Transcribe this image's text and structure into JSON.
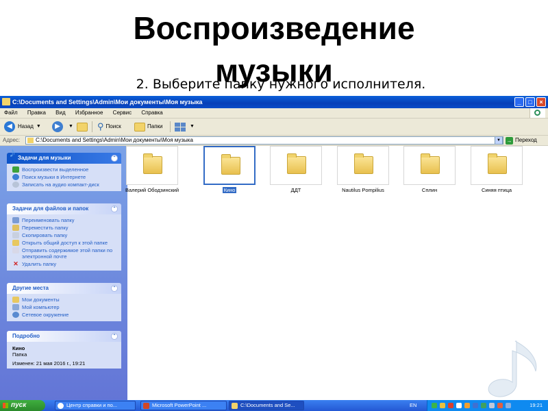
{
  "slide": {
    "title_line1": "Воспроизведение",
    "title_line2": "музыки",
    "subtitle": "2. Выберите папку нужного исполнителя."
  },
  "window": {
    "title": "C:\\Documents and Settings\\Admin\\Мои документы\\Моя музыка",
    "menu": [
      "Файл",
      "Правка",
      "Вид",
      "Избранное",
      "Сервис",
      "Справка"
    ],
    "toolbar": {
      "back_label": "Назад",
      "search_label": "Поиск",
      "folders_label": "Папки"
    },
    "address": {
      "label": "Адрес:",
      "value": "C:\\Documents and Settings\\Admin\\Мои документы\\Моя музыка",
      "go_label": "Переход"
    }
  },
  "taskpane": {
    "music_tasks": {
      "header": "Задачи для музыки",
      "items": [
        "Воспроизвести выделенное",
        "Поиск музыки в Интернете",
        "Записать на аудио компакт-диск"
      ]
    },
    "file_tasks": {
      "header": "Задачи для файлов и папок",
      "items": [
        "Переименовать папку",
        "Переместить папку",
        "Скопировать папку",
        "Открыть общий доступ к этой папке",
        "Отправить содержимое этой папки по электронной почте",
        "Удалить папку"
      ]
    },
    "other_places": {
      "header": "Другие места",
      "items": [
        "Мои документы",
        "Мой компьютер",
        "Сетевое окружение"
      ]
    },
    "details": {
      "header": "Подробно",
      "name": "Кино",
      "type": "Папка",
      "modified": "Изменен: 21 мая 2016 г., 19:21"
    }
  },
  "folders": [
    {
      "name": "Валерий Ободзинский",
      "selected": false
    },
    {
      "name": "Кино",
      "selected": true
    },
    {
      "name": "ДДТ",
      "selected": false
    },
    {
      "name": "Nautilus Pompilius",
      "selected": false
    },
    {
      "name": "Сплин",
      "selected": false
    },
    {
      "name": "Синяя птица",
      "selected": false
    }
  ],
  "taskbar": {
    "start_label": "пуск",
    "tasks": [
      "Центр справки и по...",
      "Microsoft PowerPoint ...",
      "C:\\Documents and Se..."
    ],
    "lang": "EN",
    "clock": "19:21"
  },
  "colors": {
    "title_bar": "#0a5fd8",
    "task_pane": "#7ba2e7",
    "selection": "#316ac5",
    "start_button": "#3fae3f"
  },
  "icons": [
    "folder-icon",
    "back-icon",
    "forward-icon",
    "search-icon",
    "views-icon",
    "go-icon",
    "music-note-icon"
  ]
}
